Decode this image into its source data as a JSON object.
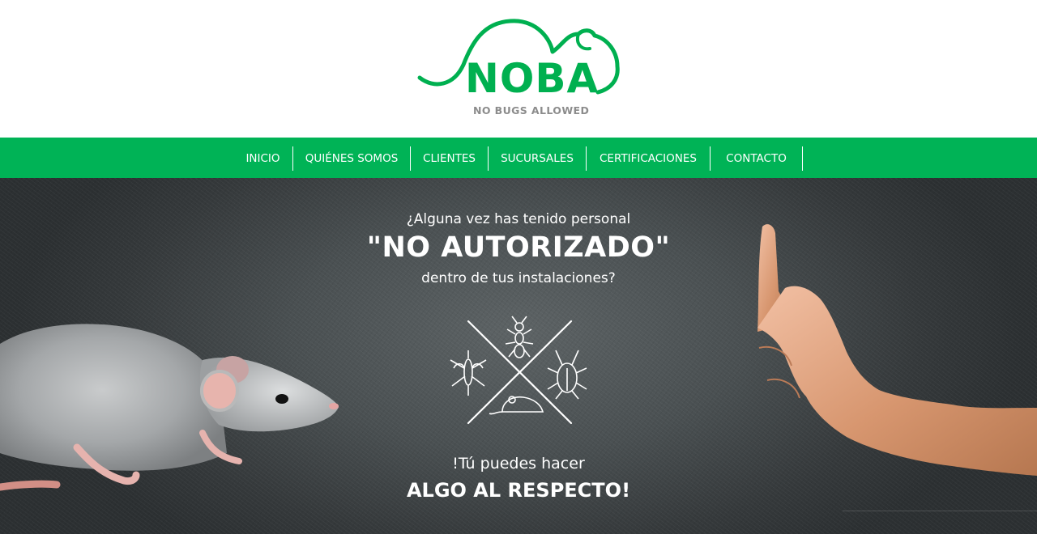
{
  "brand": {
    "name": "NOBA",
    "tagline": "NO BUGS ALLOWED",
    "color": "#00b050"
  },
  "nav": {
    "background": "#00b356",
    "items": [
      {
        "label": "INICIO"
      },
      {
        "label": "QUIÉNES SOMOS"
      },
      {
        "label": "CLIENTES"
      },
      {
        "label": "SUCURSALES"
      },
      {
        "label": "CERTIFICACIONES"
      },
      {
        "label": "CONTACTO"
      }
    ]
  },
  "hero": {
    "question": "¿Alguna vez has tenido personal",
    "highlight": "\"NO AUTORIZADO\"",
    "question_end": "dentro de tus instalaciones?",
    "call_line1": "!Tú puedes hacer",
    "call_line2": "ALGO AL RESPECTO!",
    "icons": [
      "mosquito-icon",
      "ant-icon",
      "cockroach-icon",
      "mouse-icon"
    ]
  }
}
